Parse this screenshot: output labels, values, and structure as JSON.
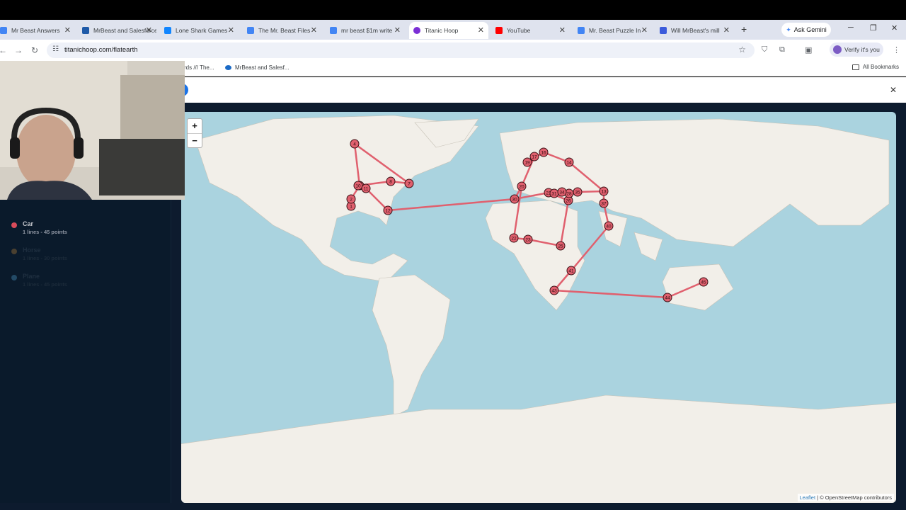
{
  "browser": {
    "tabs": [
      {
        "title": "Mr Beast Answers",
        "fav_color": "#4285f4"
      },
      {
        "title": "MrBeast and Salesforce",
        "fav_color": "#1e5aa8"
      },
      {
        "title": "Lone Shark Games",
        "fav_color": "#1185fe"
      },
      {
        "title": "The Mr. Beast Files",
        "fav_color": "#4285f4"
      },
      {
        "title": "mr beast $1m write",
        "fav_color": "#4285f4"
      },
      {
        "title": "Titanic Hoop",
        "fav_color": "#7b2fd6"
      },
      {
        "title": "YouTube",
        "fav_color": "#ff0000"
      },
      {
        "title": "Mr. Beast Puzzle In",
        "fav_color": "#4285f4"
      },
      {
        "title": "Will MrBeast's mill",
        "fav_color": "#3b5bdb"
      }
    ],
    "active_tab": "Titanic Hoop",
    "new_tab_label": "+",
    "gemini_label": "Ask Gemini",
    "url": "titanichoop.com/flatearth",
    "verify_label": "Verify it's you",
    "bookmarks": [
      {
        "label": "rds /// The..."
      },
      {
        "label": "MrBeast and Salesf..."
      }
    ],
    "all_bookmarks_label": "All Bookmarks"
  },
  "sidebar": {
    "legend": [
      {
        "name": "Car",
        "stats": "1 lines - 45 points",
        "color": "#d94b5a",
        "dim": false
      },
      {
        "name": "Horse",
        "stats": "1 lines - 30 points",
        "color": "#4a4030",
        "dim": true
      },
      {
        "name": "Plane",
        "stats": "1 lines - 45 points",
        "color": "#234a66",
        "dim": true
      }
    ]
  },
  "map": {
    "zoom_in": "+",
    "zoom_out": "−",
    "attribution_leaflet": "Leaflet",
    "attribution_rest": "| © OpenStreetMap contributors",
    "route_color": "#e0606e",
    "marker_labels": [
      "1",
      "2",
      "3",
      "4",
      "7",
      "8",
      "10",
      "11",
      "12",
      "13",
      "14",
      "16",
      "17",
      "19",
      "20",
      "21",
      "22",
      "23",
      "25",
      "26",
      "28",
      "30",
      "31",
      "34",
      "35",
      "37",
      "40",
      "41",
      "43",
      "44",
      "45"
    ]
  }
}
